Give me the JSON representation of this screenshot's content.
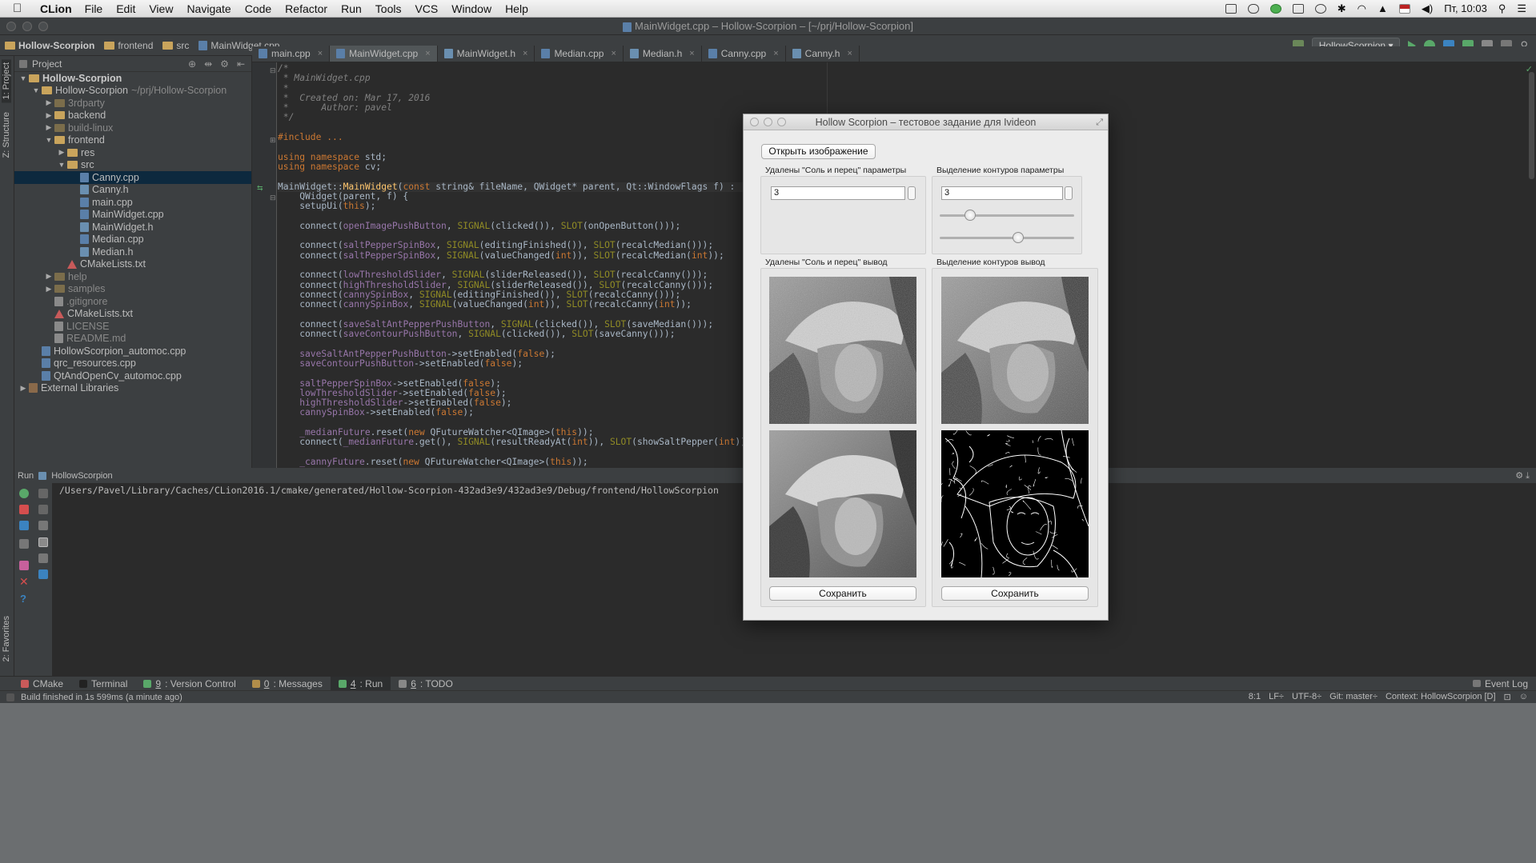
{
  "menubar": {
    "app": "CLion",
    "items": [
      "File",
      "Edit",
      "View",
      "Navigate",
      "Code",
      "Refactor",
      "Run",
      "Tools",
      "VCS",
      "Window",
      "Help"
    ],
    "clock": "Пт, 10:03"
  },
  "window_title": "MainWidget.cpp – Hollow-Scorpion – [~/prj/Hollow-Scorpion]",
  "breadcrumbs": [
    "Hollow-Scorpion",
    "frontend",
    "src",
    "MainWidget.cpp"
  ],
  "run_config": "HollowScorpion",
  "project_panel": {
    "title": "Project",
    "tree": [
      {
        "label": "Hollow-Scorpion",
        "indent": 0,
        "arrow": "▼",
        "kind": "folder",
        "bold": true
      },
      {
        "label": "Hollow-Scorpion",
        "sub": "~/prj/Hollow-Scorpion",
        "indent": 1,
        "arrow": "▼",
        "kind": "folder"
      },
      {
        "label": "3rdparty",
        "indent": 2,
        "arrow": "▶",
        "kind": "folder-dark",
        "dim": true
      },
      {
        "label": "backend",
        "indent": 2,
        "arrow": "▶",
        "kind": "folder"
      },
      {
        "label": "build-linux",
        "indent": 2,
        "arrow": "▶",
        "kind": "folder-dark",
        "dim": true
      },
      {
        "label": "frontend",
        "indent": 2,
        "arrow": "▼",
        "kind": "folder"
      },
      {
        "label": "res",
        "indent": 3,
        "arrow": "▶",
        "kind": "folder"
      },
      {
        "label": "src",
        "indent": 3,
        "arrow": "▼",
        "kind": "folder"
      },
      {
        "label": "Canny.cpp",
        "indent": 4,
        "arrow": "",
        "kind": "cpp",
        "selected": true
      },
      {
        "label": "Canny.h",
        "indent": 4,
        "arrow": "",
        "kind": "h"
      },
      {
        "label": "main.cpp",
        "indent": 4,
        "arrow": "",
        "kind": "cpp"
      },
      {
        "label": "MainWidget.cpp",
        "indent": 4,
        "arrow": "",
        "kind": "cpp"
      },
      {
        "label": "MainWidget.h",
        "indent": 4,
        "arrow": "",
        "kind": "h"
      },
      {
        "label": "Median.cpp",
        "indent": 4,
        "arrow": "",
        "kind": "cpp"
      },
      {
        "label": "Median.h",
        "indent": 4,
        "arrow": "",
        "kind": "h"
      },
      {
        "label": "CMakeLists.txt",
        "indent": 3,
        "arrow": "",
        "kind": "cmake"
      },
      {
        "label": "help",
        "indent": 2,
        "arrow": "▶",
        "kind": "folder-dark",
        "dim": true
      },
      {
        "label": "samples",
        "indent": 2,
        "arrow": "▶",
        "kind": "folder-dark",
        "dim": true
      },
      {
        "label": ".gitignore",
        "indent": 2,
        "arrow": "",
        "kind": "txt",
        "dim": true
      },
      {
        "label": "CMakeLists.txt",
        "indent": 2,
        "arrow": "",
        "kind": "cmake"
      },
      {
        "label": "LICENSE",
        "indent": 2,
        "arrow": "",
        "kind": "txt",
        "dim": true
      },
      {
        "label": "README.md",
        "indent": 2,
        "arrow": "",
        "kind": "txt",
        "dim": true
      },
      {
        "label": "HollowScorpion_automoc.cpp",
        "indent": 1,
        "arrow": "",
        "kind": "cpp"
      },
      {
        "label": "qrc_resources.cpp",
        "indent": 1,
        "arrow": "",
        "kind": "cpp"
      },
      {
        "label": "QtAndOpenCv_automoc.cpp",
        "indent": 1,
        "arrow": "",
        "kind": "cpp"
      },
      {
        "label": "External Libraries",
        "indent": 0,
        "arrow": "▶",
        "kind": "lib"
      }
    ]
  },
  "tabs": [
    {
      "label": "main.cpp",
      "kind": "cpp"
    },
    {
      "label": "MainWidget.cpp",
      "kind": "cpp",
      "active": true
    },
    {
      "label": "MainWidget.h",
      "kind": "h"
    },
    {
      "label": "Median.cpp",
      "kind": "cpp"
    },
    {
      "label": "Median.h",
      "kind": "h"
    },
    {
      "label": "Canny.cpp",
      "kind": "cpp"
    },
    {
      "label": "Canny.h",
      "kind": "h"
    }
  ],
  "code_lines": [
    [
      [
        "cm",
        "/*"
      ]
    ],
    [
      [
        "cm",
        " * MainWidget.cpp"
      ]
    ],
    [
      [
        "cm",
        " *"
      ]
    ],
    [
      [
        "cm",
        " *  Created on: Mar 17, 2016"
      ]
    ],
    [
      [
        "cm",
        " *      Author: pavel"
      ]
    ],
    [
      [
        "cm",
        " */"
      ]
    ],
    [],
    [
      [
        "kw",
        "#include"
      ],
      [
        "",
        " "
      ],
      [
        "hl",
        "..."
      ]
    ],
    [],
    [
      [
        "kw",
        "using namespace"
      ],
      [
        "",
        " std;"
      ]
    ],
    [
      [
        "kw",
        "using namespace"
      ],
      [
        "",
        " cv;"
      ]
    ],
    [],
    [
      [
        "",
        "MainWidget::"
      ],
      [
        "fn",
        "MainWidget"
      ],
      [
        "",
        "("
      ],
      [
        "kw",
        "const"
      ],
      [
        "",
        " string& fileName, QWidget* parent, Qt::WindowFlags f) :"
      ]
    ],
    [
      [
        "",
        "    QWidget(parent, f) {"
      ]
    ],
    [
      [
        "",
        "    setupUi("
      ],
      [
        "kw",
        "this"
      ],
      [
        "",
        ");"
      ]
    ],
    [],
    [
      [
        "",
        "    connect("
      ],
      [
        "fld",
        "openImagePushButton"
      ],
      [
        "",
        ", "
      ],
      [
        "mac",
        "SIGNAL"
      ],
      [
        "",
        "(clicked()), "
      ],
      [
        "mac",
        "SLOT"
      ],
      [
        "",
        "(onOpenButton()));"
      ]
    ],
    [],
    [
      [
        "",
        "    connect("
      ],
      [
        "fld",
        "saltPepperSpinBox"
      ],
      [
        "",
        ", "
      ],
      [
        "mac",
        "SIGNAL"
      ],
      [
        "",
        "(editingFinished()), "
      ],
      [
        "mac",
        "SLOT"
      ],
      [
        "",
        "(recalcMedian()));"
      ]
    ],
    [
      [
        "",
        "    connect("
      ],
      [
        "fld",
        "saltPepperSpinBox"
      ],
      [
        "",
        ", "
      ],
      [
        "mac",
        "SIGNAL"
      ],
      [
        "",
        "(valueChanged("
      ],
      [
        "kw",
        "int"
      ],
      [
        "",
        ")), "
      ],
      [
        "mac",
        "SLOT"
      ],
      [
        "",
        "(recalcMedian("
      ],
      [
        "kw",
        "int"
      ],
      [
        "",
        "));"
      ]
    ],
    [],
    [
      [
        "",
        "    connect("
      ],
      [
        "fld",
        "lowThresholdSlider"
      ],
      [
        "",
        ", "
      ],
      [
        "mac",
        "SIGNAL"
      ],
      [
        "",
        "(sliderReleased()), "
      ],
      [
        "mac",
        "SLOT"
      ],
      [
        "",
        "(recalcCanny()));"
      ]
    ],
    [
      [
        "",
        "    connect("
      ],
      [
        "fld",
        "highThresholdSlider"
      ],
      [
        "",
        ", "
      ],
      [
        "mac",
        "SIGNAL"
      ],
      [
        "",
        "(sliderReleased()), "
      ],
      [
        "mac",
        "SLOT"
      ],
      [
        "",
        "(recalcCanny()));"
      ]
    ],
    [
      [
        "",
        "    connect("
      ],
      [
        "fld",
        "cannySpinBox"
      ],
      [
        "",
        ", "
      ],
      [
        "mac",
        "SIGNAL"
      ],
      [
        "",
        "(editingFinished()), "
      ],
      [
        "mac",
        "SLOT"
      ],
      [
        "",
        "(recalcCanny()));"
      ]
    ],
    [
      [
        "",
        "    connect("
      ],
      [
        "fld",
        "cannySpinBox"
      ],
      [
        "",
        ", "
      ],
      [
        "mac",
        "SIGNAL"
      ],
      [
        "",
        "(valueChanged("
      ],
      [
        "kw",
        "int"
      ],
      [
        "",
        ")), "
      ],
      [
        "mac",
        "SLOT"
      ],
      [
        "",
        "(recalcCanny("
      ],
      [
        "kw",
        "int"
      ],
      [
        "",
        "));"
      ]
    ],
    [],
    [
      [
        "",
        "    connect("
      ],
      [
        "fld",
        "saveSaltAntPepperPushButton"
      ],
      [
        "",
        ", "
      ],
      [
        "mac",
        "SIGNAL"
      ],
      [
        "",
        "(clicked()), "
      ],
      [
        "mac",
        "SLOT"
      ],
      [
        "",
        "(saveMedian()));"
      ]
    ],
    [
      [
        "",
        "    connect("
      ],
      [
        "fld",
        "saveContourPushButton"
      ],
      [
        "",
        ", "
      ],
      [
        "mac",
        "SIGNAL"
      ],
      [
        "",
        "(clicked()), "
      ],
      [
        "mac",
        "SLOT"
      ],
      [
        "",
        "(saveCanny()));"
      ]
    ],
    [],
    [
      [
        "fld",
        "    saveSaltAntPepperPushButton"
      ],
      [
        "",
        "->setEnabled("
      ],
      [
        "kw",
        "false"
      ],
      [
        "",
        ");"
      ]
    ],
    [
      [
        "fld",
        "    saveContourPushButton"
      ],
      [
        "",
        "->setEnabled("
      ],
      [
        "kw",
        "false"
      ],
      [
        "",
        ");"
      ]
    ],
    [],
    [
      [
        "fld",
        "    saltPepperSpinBox"
      ],
      [
        "",
        "->setEnabled("
      ],
      [
        "kw",
        "false"
      ],
      [
        "",
        ");"
      ]
    ],
    [
      [
        "fld",
        "    lowThresholdSlider"
      ],
      [
        "",
        "->setEnabled("
      ],
      [
        "kw",
        "false"
      ],
      [
        "",
        ");"
      ]
    ],
    [
      [
        "fld",
        "    highThresholdSlider"
      ],
      [
        "",
        "->setEnabled("
      ],
      [
        "kw",
        "false"
      ],
      [
        "",
        ");"
      ]
    ],
    [
      [
        "fld",
        "    cannySpinBox"
      ],
      [
        "",
        "->setEnabled("
      ],
      [
        "kw",
        "false"
      ],
      [
        "",
        ");"
      ]
    ],
    [],
    [
      [
        "fld",
        "    _medianFuture"
      ],
      [
        "",
        ".reset("
      ],
      [
        "kw",
        "new"
      ],
      [
        "",
        " QFutureWatcher<QImage>("
      ],
      [
        "kw",
        "this"
      ],
      [
        "",
        "));"
      ]
    ],
    [
      [
        "",
        "    connect("
      ],
      [
        "fld",
        "_medianFuture"
      ],
      [
        "",
        ".get(), "
      ],
      [
        "mac",
        "SIGNAL"
      ],
      [
        "",
        "(resultReadyAt("
      ],
      [
        "kw",
        "int"
      ],
      [
        "",
        ")), "
      ],
      [
        "mac",
        "SLOT"
      ],
      [
        "",
        "(showSaltPepper("
      ],
      [
        "kw",
        "int"
      ],
      [
        "",
        "));"
      ]
    ],
    [],
    [
      [
        "fld",
        "    _cannyFuture"
      ],
      [
        "",
        ".reset("
      ],
      [
        "kw",
        "new"
      ],
      [
        "",
        " QFutureWatcher<QImage>("
      ],
      [
        "kw",
        "this"
      ],
      [
        "",
        "));"
      ]
    ]
  ],
  "run_panel": {
    "label": "Run",
    "config": "HollowScorpion",
    "output": "/Users/Pavel/Library/Caches/CLion2016.1/cmake/generated/Hollow-Scorpion-432ad3e9/432ad3e9/Debug/frontend/HollowScorpion"
  },
  "bottom_tools": [
    {
      "label": "CMake"
    },
    {
      "label": "Terminal"
    },
    {
      "num": "9",
      "label": ": Version Control"
    },
    {
      "num": "0",
      "label": ": Messages"
    },
    {
      "num": "4",
      "label": ": Run",
      "active": true
    },
    {
      "num": "6",
      "label": ": TODO"
    }
  ],
  "event_log": "Event Log",
  "status": {
    "message": "Build finished in 1s 599ms (a minute ago)",
    "position": "8:1",
    "line_sep": "LF÷",
    "encoding": "UTF-8÷",
    "git": "Git: master÷",
    "context": "Context: HollowScorpion [D]"
  },
  "side_tabs": {
    "project": "1: Project",
    "structure": "Z: Structure",
    "favorites": "2: Favorites"
  },
  "qt_window": {
    "title": "Hollow Scorpion – тестовое задание для Ivideon",
    "open_button": "Открыть изображение",
    "salt_params_label": "Удалены \"Соль и перец\" параметры",
    "contour_params_label": "Выделение контуров параметры",
    "salt_spin_value": "3",
    "canny_spin_value": "3",
    "low_threshold": 0.2,
    "high_threshold": 0.59,
    "salt_output_label": "Удалены \"Соль и перец\" вывод",
    "contour_output_label": "Выделение контуров вывод",
    "save_label": "Сохранить"
  },
  "colors": {
    "accent_run": "#59a869",
    "selection": "#0d293e",
    "editor_bg": "#2b2b2b",
    "panel_bg": "#3c3f41"
  }
}
